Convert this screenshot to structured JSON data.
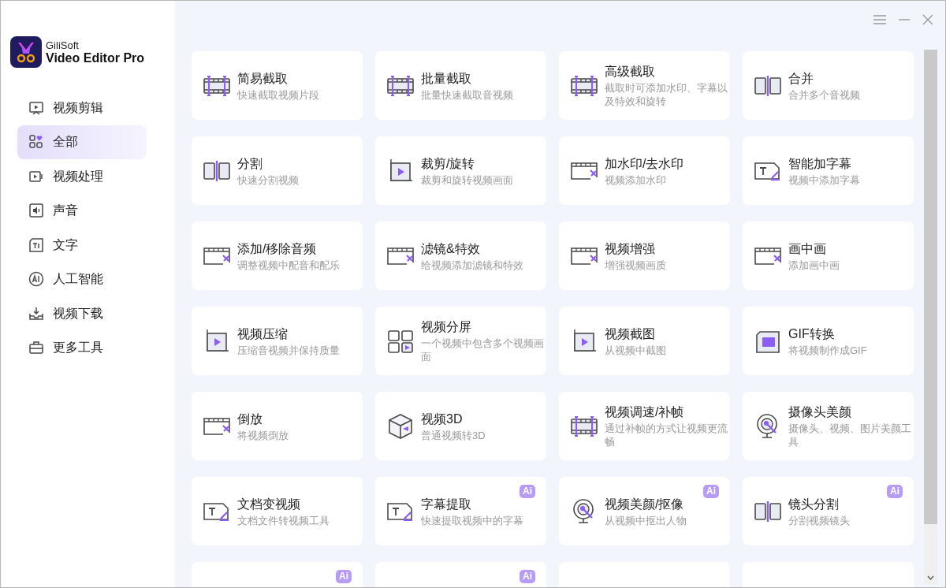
{
  "app": {
    "brand": "GiliSoft",
    "product": "Video Editor Pro"
  },
  "sidebar": {
    "items": [
      {
        "label": "视频剪辑",
        "selected": false
      },
      {
        "label": "全部",
        "selected": true
      },
      {
        "label": "视频处理",
        "selected": false
      },
      {
        "label": "声音",
        "selected": false
      },
      {
        "label": "文字",
        "selected": false
      },
      {
        "label": "人工智能",
        "selected": false
      },
      {
        "label": "视频下载",
        "selected": false
      },
      {
        "label": "更多工具",
        "selected": false
      }
    ]
  },
  "tools": [
    {
      "kind": "tool",
      "title": "简易截取",
      "subtitle": "快速截取视频片段"
    },
    {
      "kind": "tool",
      "title": "批量截取",
      "subtitle": "批量快速截取音视频"
    },
    {
      "kind": "tool",
      "title": "高级截取",
      "subtitle": "截取时可添加水印、字幕以及特效和旋转"
    },
    {
      "kind": "tool",
      "title": "合并",
      "subtitle": "合并多个音视频"
    },
    {
      "kind": "tool",
      "title": "分割",
      "subtitle": "快速分割视频"
    },
    {
      "kind": "tool",
      "title": "裁剪/旋转",
      "subtitle": "裁剪和旋转视频画面"
    },
    {
      "kind": "tool",
      "title": "加水印/去水印",
      "subtitle": "视频添加水印"
    },
    {
      "kind": "tool",
      "title": "智能加字幕",
      "subtitle": "视频中添加字幕"
    },
    {
      "kind": "tool",
      "title": "添加/移除音频",
      "subtitle": "调整视频中配音和配乐"
    },
    {
      "kind": "tool",
      "title": "滤镜&特效",
      "subtitle": "给视频添加滤镜和特效"
    },
    {
      "kind": "tool",
      "title": "视频增强",
      "subtitle": "增强视频画质"
    },
    {
      "kind": "tool",
      "title": "画中画",
      "subtitle": "添加画中画"
    },
    {
      "kind": "tool",
      "title": "视频压缩",
      "subtitle": "压缩音视频并保持质量"
    },
    {
      "kind": "tool",
      "title": "视频分屏",
      "subtitle": "一个视频中包含多个视频画面"
    },
    {
      "kind": "tool",
      "title": "视频截图",
      "subtitle": "从视频中截图"
    },
    {
      "kind": "tool",
      "title": "GIF转换",
      "subtitle": "将视频制作成GIF"
    },
    {
      "kind": "tool",
      "title": "倒放",
      "subtitle": "将视频倒放"
    },
    {
      "kind": "tool",
      "title": "视频3D",
      "subtitle": "普通视频转3D"
    },
    {
      "kind": "tool",
      "title": "视频调速/补帧",
      "subtitle": "通过补帧的方式让视频更流畅"
    },
    {
      "kind": "tool",
      "title": "摄像头美颜",
      "subtitle": "摄像头、视频、图片美颜工具"
    },
    {
      "kind": "tool",
      "title": "文档变视频",
      "subtitle": "文档文件转视频工具"
    },
    {
      "kind": "tool",
      "title": "字幕提取",
      "subtitle": "快速提取视频中的字幕",
      "badge": "Ai"
    },
    {
      "kind": "tool",
      "title": "视频美颜/抠像",
      "subtitle": "从视频中抠出人物",
      "badge": "Ai"
    },
    {
      "kind": "tool",
      "title": "镜头分割",
      "subtitle": "分割视频镜头",
      "badge": "Ai"
    },
    {
      "kind": "clipped",
      "badge": "Ai"
    },
    {
      "kind": "clipped",
      "badge": "Ai"
    },
    {
      "kind": "clipped"
    },
    {
      "kind": "clipped"
    }
  ]
}
